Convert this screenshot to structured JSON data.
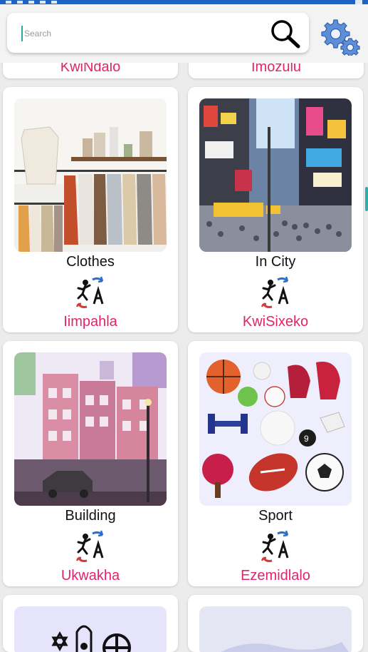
{
  "search": {
    "placeholder": "Search",
    "value": ""
  },
  "row0": [
    {
      "xhosa": "KwiNdalo"
    },
    {
      "xhosa": "Imozulu"
    }
  ],
  "cards": [
    {
      "english": "Clothes",
      "xhosa": "Iimpahla",
      "image": "clothes-rack-photo"
    },
    {
      "english": "In City",
      "xhosa": "KwiSixeko",
      "image": "city-street-photo"
    },
    {
      "english": "Building",
      "xhosa": "Ukwakha",
      "image": "building-illustration"
    },
    {
      "english": "Sport",
      "xhosa": "Ezemidlalo",
      "image": "sports-balls-illustration"
    }
  ],
  "icons": {
    "search": "search-icon",
    "settings": "gear-icon",
    "card_logo": "translate-person-logo"
  },
  "colors": {
    "statusbar": "#1c63c6",
    "xhosa_text": "#e0246a",
    "accent": "#2ab0b0",
    "card_bg": "#ffffff",
    "page_bg": "#ececec"
  }
}
